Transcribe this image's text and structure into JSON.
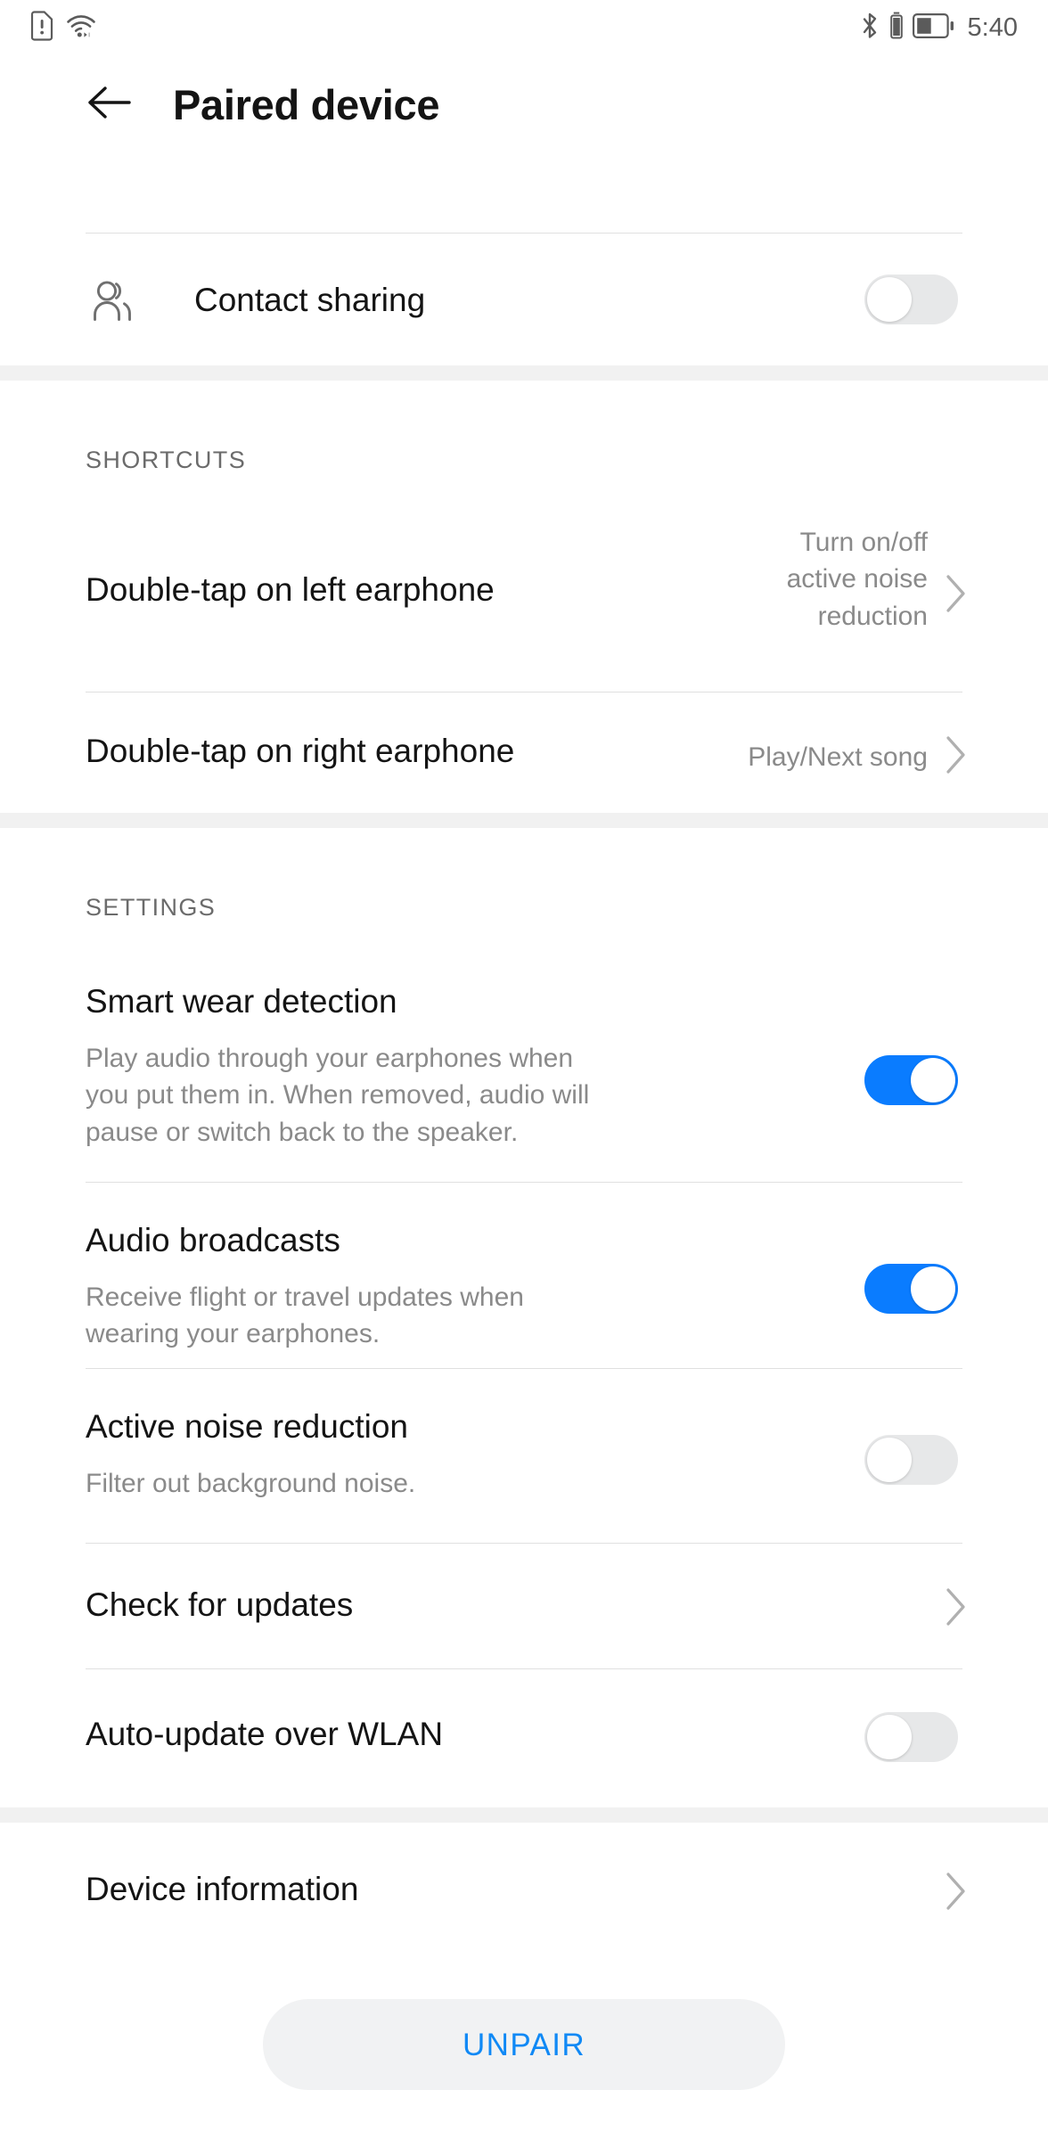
{
  "status_bar": {
    "left_icons": [
      "sim-card-alert-icon",
      "wifi-icon"
    ],
    "right_icons": [
      "bluetooth-icon",
      "vibrate-icon",
      "battery-icon"
    ],
    "battery_level_percent": 45,
    "time": "5:40"
  },
  "app_bar": {
    "back_icon": "back-arrow-icon",
    "title": "Paired device"
  },
  "top_section": {
    "contact_sharing": {
      "icon": "contacts-icon",
      "label": "Contact sharing",
      "toggle_state": "off"
    }
  },
  "shortcuts_section": {
    "header": "SHORTCUTS",
    "items": [
      {
        "label": "Double-tap on left earphone",
        "value": "Turn on/off active noise reduction",
        "value_lines": [
          "Turn on/off",
          "active noise",
          "reduction"
        ],
        "accessory": "chevron-right-icon"
      },
      {
        "label": "Double-tap on right earphone",
        "value": "Play/Next song",
        "value_lines": [
          "Play/Next song"
        ],
        "accessory": "chevron-right-icon"
      }
    ]
  },
  "settings_section": {
    "header": "SETTINGS",
    "items": [
      {
        "label": "Smart wear detection",
        "description": "Play audio through your earphones when you put them in. When removed, audio will pause or switch back to the speaker.",
        "description_lines": [
          "Play audio through your earphones when",
          "you put them in. When removed, audio will",
          "pause or switch back to the speaker."
        ],
        "toggle_state": "on"
      },
      {
        "label": "Audio broadcasts",
        "description": "Receive flight or travel updates when wearing your earphones.",
        "description_lines": [
          "Receive flight or travel updates when",
          "wearing your earphones."
        ],
        "toggle_state": "on"
      },
      {
        "label": "Active noise reduction",
        "description": "Filter out background noise.",
        "description_lines": [
          "Filter out background noise."
        ],
        "toggle_state": "off"
      },
      {
        "label": "Check for updates",
        "accessory": "chevron-right-icon"
      },
      {
        "label": "Auto-update over WLAN",
        "toggle_state": "off"
      }
    ]
  },
  "device_section": {
    "items": [
      {
        "label": "Device information",
        "accessory": "chevron-right-icon"
      }
    ]
  },
  "footer": {
    "unpair_label": "UNPAIR"
  },
  "colors": {
    "accent_blue": "#0a7cff",
    "unpair_text": "#1089f5",
    "unpair_bg": "#f1f2f3",
    "band_gray": "#f1f1f1",
    "divider": "#e0e0e0",
    "primary_text": "#141414",
    "secondary_text": "#8a8a8a",
    "toggle_off": "#e7e8e9"
  }
}
